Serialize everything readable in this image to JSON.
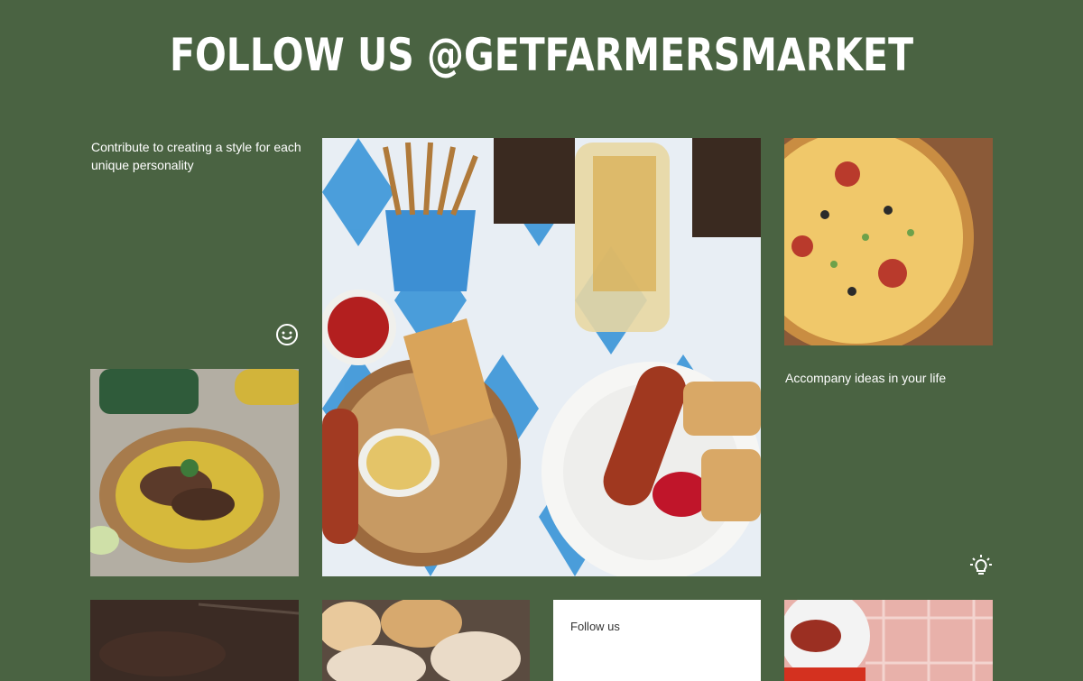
{
  "header": {
    "title": "FOLLOW US @GETFARMERSMARKET"
  },
  "tiles": {
    "text1": "Contribute to creating a style for each unique personality",
    "text2": "Accompany ideas in your life",
    "follow_card": "Follow us"
  },
  "icons": {
    "smile": "smile-icon",
    "bulb": "lightbulb-icon"
  },
  "colors": {
    "background": "#4a6342",
    "title": "#ffffff",
    "card": "#ffffff"
  }
}
